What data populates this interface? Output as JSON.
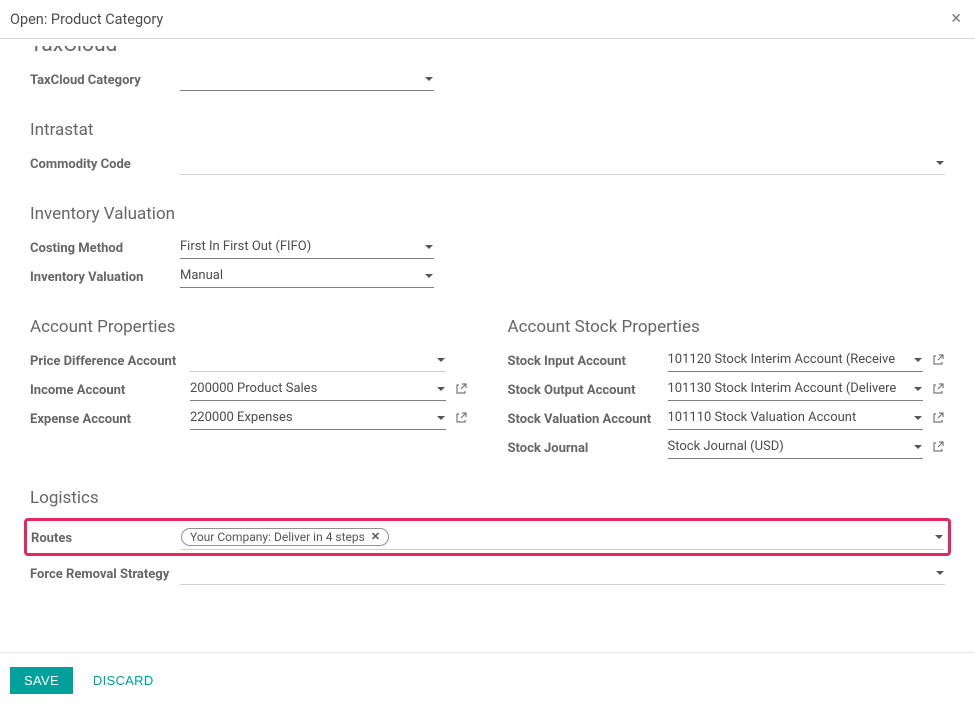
{
  "header": {
    "title": "Open: Product Category"
  },
  "sections": {
    "taxcloud_partial": "TaxCloud",
    "sec_intrastat": "Intrastat",
    "sec_inv_val": "Inventory Valuation",
    "sec_acct_props": "Account Properties",
    "sec_acct_stock_props": "Account Stock Properties",
    "sec_logistics": "Logistics"
  },
  "labels": {
    "taxcloud_category": "TaxCloud Category",
    "commodity_code": "Commodity Code",
    "costing_method": "Costing Method",
    "inventory_valuation": "Inventory Valuation",
    "price_diff_account": "Price Difference Account",
    "income_account": "Income Account",
    "expense_account": "Expense Account",
    "stock_input_account": "Stock Input Account",
    "stock_output_account": "Stock Output Account",
    "stock_valuation_account": "Stock Valuation Account",
    "stock_journal": "Stock Journal",
    "routes": "Routes",
    "force_removal": "Force Removal Strategy"
  },
  "values": {
    "taxcloud_category": "",
    "commodity_code": "",
    "costing_method": "First In First Out (FIFO)",
    "inventory_valuation": "Manual",
    "price_diff_account": "",
    "income_account": "200000 Product Sales",
    "expense_account": "220000 Expenses",
    "stock_input_account": "101120 Stock Interim Account (Receive",
    "stock_output_account": "101130 Stock Interim Account (Delivere",
    "stock_valuation_account": "101110 Stock Valuation Account",
    "stock_journal": "Stock Journal (USD)",
    "force_removal": ""
  },
  "routes_tag": "Your Company: Deliver in 4 steps",
  "footer": {
    "save": "Save",
    "discard": "Discard"
  }
}
